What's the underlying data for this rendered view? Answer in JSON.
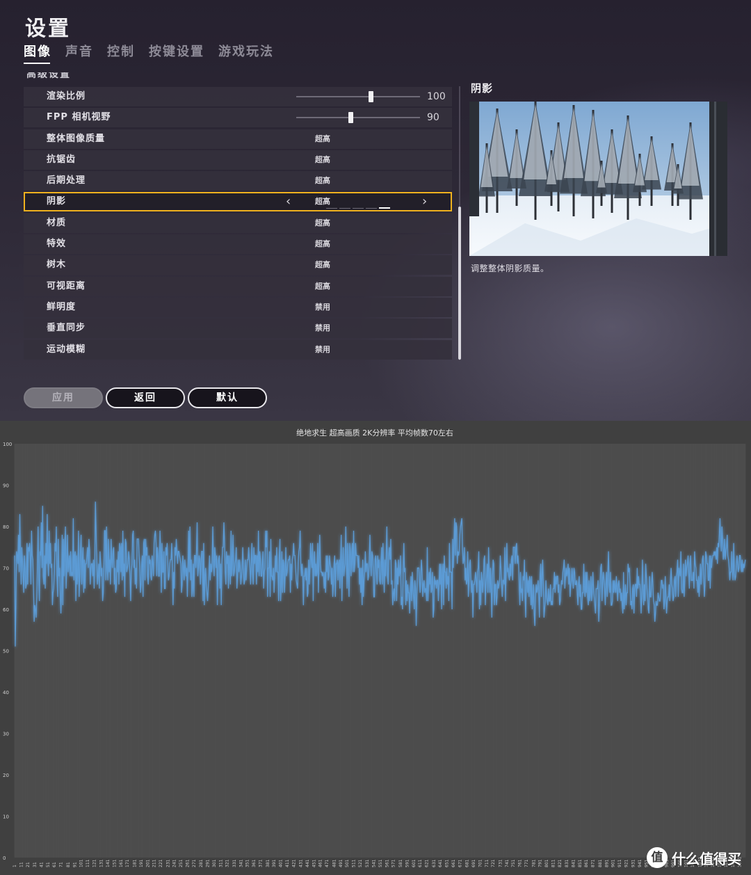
{
  "header": {
    "title": "设置",
    "tabs": [
      {
        "label": "图像",
        "active": true
      },
      {
        "label": "声音",
        "active": false
      },
      {
        "label": "控制",
        "active": false
      },
      {
        "label": "按键设置",
        "active": false
      },
      {
        "label": "游戏玩法",
        "active": false
      }
    ]
  },
  "section_label": "高级设置",
  "settings": {
    "rows": [
      {
        "label": "渲染比例",
        "type": "slider",
        "value": "100",
        "slider_fraction": 0.6
      },
      {
        "label": "FPP 相机视野",
        "type": "slider",
        "value": "90",
        "slider_fraction": 0.44
      },
      {
        "label": "整体图像质量",
        "type": "option",
        "value": "超高"
      },
      {
        "label": "抗锯齿",
        "type": "option",
        "value": "超高"
      },
      {
        "label": "后期处理",
        "type": "option",
        "value": "超高"
      },
      {
        "label": "阴影",
        "type": "option",
        "value": "超高",
        "selected": true,
        "level_index": 4,
        "level_count": 5
      },
      {
        "label": "材质",
        "type": "option",
        "value": "超高"
      },
      {
        "label": "特效",
        "type": "option",
        "value": "超高"
      },
      {
        "label": "树木",
        "type": "option",
        "value": "超高"
      },
      {
        "label": "可视距离",
        "type": "option",
        "value": "超高"
      },
      {
        "label": "鲜明度",
        "type": "option",
        "value": "禁用"
      },
      {
        "label": "垂直同步",
        "type": "option",
        "value": "禁用"
      },
      {
        "label": "运动模糊",
        "type": "option",
        "value": "禁用"
      }
    ],
    "arrow_left": "‹",
    "arrow_right": "›"
  },
  "preview": {
    "title": "阴影",
    "description": "调整整体阴影质量。",
    "image": "snowy-pine-forest-scene"
  },
  "buttons": {
    "apply": "应用",
    "back": "返回",
    "default": "默认"
  },
  "watermark": {
    "logo": "值",
    "text": "什么值得买"
  },
  "colors": {
    "accent_selected": "#f0b21e",
    "line": "#5b9bd5"
  },
  "chart_data": {
    "type": "line",
    "title": "绝地求生 超高画质 2K分辨率 平均帧数70左右",
    "xlabel": "",
    "ylabel": "",
    "ylim": [
      0,
      100
    ],
    "yticks": [
      0,
      10,
      20,
      30,
      40,
      50,
      60,
      70,
      80,
      90,
      100
    ],
    "x_range": [
      1,
      1100
    ],
    "xtick_step": 10,
    "grid": true,
    "series": [
      {
        "values": [
          73,
          51,
          61,
          74,
          73,
          71,
          78,
          69,
          83,
          73,
          66,
          75,
          72,
          68,
          64,
          73,
          70,
          65,
          66,
          76,
          66,
          75,
          74,
          76,
          73,
          66,
          79,
          73,
          72,
          65,
          57,
          61,
          60,
          58,
          63,
          71,
          80,
          67,
          62,
          74,
          73,
          81,
          70,
          85,
          68,
          66,
          73,
          65,
          76,
          71,
          83,
          72,
          68,
          79,
          71,
          76,
          70,
          71,
          61,
          64,
          65,
          69,
          76,
          74,
          80,
          68,
          63,
          77,
          68,
          70,
          64,
          59,
          64,
          78,
          61,
          77,
          68,
          75,
          80,
          65,
          70,
          78,
          69,
          71,
          73,
          68,
          74,
          68,
          69,
          68,
          82,
          67,
          73,
          74,
          62,
          73,
          66,
          69,
          79,
          63,
          68,
          74,
          78,
          66,
          72,
          75,
          64,
          72,
          65,
          71,
          71,
          73,
          75,
          70,
          77,
          74,
          66,
          70,
          71,
          71,
          68,
          72,
          65,
          72,
          86,
          79,
          72,
          66,
          68,
          71,
          65,
          74,
          71,
          68,
          70,
          62,
          64,
          71,
          79,
          79,
          67,
          80,
          70,
          67,
          77,
          69,
          72,
          66,
          77,
          72,
          70,
          74,
          75,
          66,
          70,
          64,
          65,
          72,
          69,
          74,
          66,
          76,
          75,
          69,
          76,
          67,
          79,
          68,
          71,
          63,
          77,
          76,
          69,
          70,
          71,
          74,
          72,
          68,
          62,
          69,
          71,
          78,
          79,
          70,
          72,
          66,
          70,
          65,
          77,
          77,
          77,
          73,
          70,
          64,
          66,
          71,
          73,
          63,
          76,
          77,
          67,
          77,
          73,
          75,
          68,
          66,
          73,
          71,
          72,
          68,
          67,
          73,
          71,
          68,
          76,
          78,
          79,
          76,
          68,
          75,
          73,
          68,
          68,
          79,
          74,
          64,
          76,
          69,
          69,
          74,
          65,
          65,
          75,
          73,
          76,
          71,
          67,
          68,
          71,
          72,
          72,
          76,
          70,
          61,
          69,
          65,
          75,
          73,
          77,
          74,
          71,
          74,
          74,
          73,
          72,
          71,
          64,
          66,
          73,
          70,
          67,
          72,
          70,
          68,
          70,
          63,
          70,
          79,
          69,
          80,
          67,
          72,
          63,
          65,
          71,
          63,
          73,
          73,
          70,
          74,
          81,
          68,
          70,
          73,
          72,
          66,
          71,
          74,
          74,
          62,
          76,
          61,
          68,
          70,
          66,
          64,
          62,
          65,
          68,
          73,
          67,
          71,
          69,
          71,
          80,
          72,
          68,
          75,
          73,
          70,
          73,
          61,
          70,
          72,
          73,
          65,
          71,
          61,
          71,
          75,
          75,
          81,
          76,
          69,
          66,
          74,
          71,
          73,
          65,
          73,
          70,
          66,
          79,
          68,
          72,
          78,
          68,
          69,
          71,
          72,
          75,
          65,
          68,
          72,
          69,
          72,
          70,
          66,
          68,
          70,
          75,
          70,
          66,
          67,
          72,
          67,
          70,
          72,
          72,
          75,
          72,
          70,
          66,
          71,
          76,
          69,
          66,
          75,
          71,
          73,
          73,
          66,
          73,
          69,
          79,
          68,
          74,
          72,
          68,
          68,
          71,
          74,
          65,
          69,
          70,
          79,
          75,
          79,
          63,
          70,
          70,
          74,
          63,
          77,
          68,
          68,
          67,
          70,
          64,
          68,
          73,
          69,
          75,
          69,
          69,
          62,
          73,
          77,
          62,
          66,
          74,
          64,
          72,
          71,
          64,
          68,
          75,
          68,
          69,
          71,
          72,
          72,
          73,
          64,
          71,
          67,
          72,
          73,
          76,
          73,
          73,
          70,
          67,
          66,
          65,
          71,
          74,
          75,
          79,
          71,
          68,
          71,
          68,
          61,
          68,
          68,
          70,
          67,
          70,
          63,
          64,
          72,
          66,
          70,
          76,
          72,
          70,
          76,
          62,
          71,
          74,
          68,
          71,
          68,
          69,
          76,
          64,
          72,
          78,
          71,
          69,
          69,
          68,
          69,
          68,
          65,
          69,
          64,
          73,
          69,
          73,
          67,
          68,
          73,
          71,
          70,
          66,
          70,
          63,
          66,
          71,
          73,
          63,
          71,
          71,
          72,
          67,
          71,
          72,
          65,
          72,
          78,
          62,
          70,
          75,
          68,
          70,
          71,
          80,
          72,
          65,
          76,
          68,
          63,
          76,
          74,
          68,
          72,
          76,
          69,
          79,
          69,
          71,
          76,
          73,
          73,
          73,
          70,
          73,
          66,
          70,
          64,
          70,
          61,
          72,
          63,
          67,
          69,
          74,
          69,
          71,
          71,
          67,
          68,
          72,
          78,
          71,
          68,
          74,
          73,
          70,
          63,
          63,
          72,
          73,
          69,
          66,
          73,
          70,
          72,
          67,
          66,
          71,
          75,
          66,
          76,
          69,
          64,
          72,
          68,
          73,
          80,
          68,
          66,
          73,
          75,
          72,
          77,
          66,
          67,
          61,
          64,
          65,
          62,
          72,
          71,
          62,
          70,
          66,
          72,
          68,
          69,
          73,
          61,
          63,
          60,
          69,
          76,
          69,
          70,
          61,
          67,
          62,
          66,
          64,
          64,
          59,
          64,
          68,
          62,
          69,
          65,
          63,
          60,
          67,
          65,
          56,
          63,
          70,
          70,
          70,
          67,
          64,
          68,
          72,
          69,
          63,
          66,
          67,
          64,
          65,
          65,
          62,
          75,
          62,
          66,
          69,
          66,
          70,
          64,
          65,
          69,
          58,
          60,
          68,
          66,
          67,
          65,
          67,
          67,
          62,
          66,
          71,
          66,
          71,
          60,
          68,
          71,
          61,
          73,
          69,
          69,
          65,
          70,
          66,
          68,
          62,
          76,
          69,
          69,
          69,
          60,
          77,
          70,
          76,
          82,
          73,
          81,
          80,
          71,
          74,
          73,
          74,
          78,
          80,
          81,
          82,
          75,
          71,
          72,
          75,
          67,
          70,
          66,
          67,
          74,
          63,
          67,
          71,
          72,
          67,
          64,
          67,
          58,
          66,
          66,
          67,
          69,
          67,
          64,
          69,
          70,
          74,
          60,
          67,
          61,
          69,
          67,
          64,
          67,
          72,
          73,
          61,
          66,
          68,
          71,
          64,
          75,
          69,
          64,
          70,
          65,
          58,
          68,
          72,
          71,
          61,
          66,
          66,
          61,
          63,
          67,
          65,
          66,
          67,
          73,
          70,
          66,
          63,
          67,
          67,
          66,
          75,
          62,
          70,
          76,
          69,
          70,
          68,
          67,
          71,
          68,
          72,
          73,
          67,
          75,
          75,
          75,
          71,
          75,
          76,
          71,
          73,
          71,
          66,
          61,
          69,
          64,
          65,
          62,
          68,
          67,
          72,
          63,
          58,
          69,
          67,
          64,
          67,
          63,
          68,
          67,
          61,
          68,
          60,
          62,
          66,
          59,
          56,
          63,
          66,
          64,
          65,
          67,
          63,
          58,
          68,
          71,
          63,
          68,
          72,
          66,
          58,
          60,
          62,
          67,
          63,
          62,
          61,
          65,
          62,
          62,
          66,
          61,
          62,
          61,
          65,
          65,
          69,
          64,
          68,
          66,
          68,
          68,
          64,
          66,
          61,
          62,
          65,
          67,
          66,
          69,
          70,
          72,
          65,
          68,
          70,
          68,
          69,
          71,
          66,
          70,
          63,
          66,
          67,
          70,
          67,
          65,
          70,
          69,
          66,
          66,
          67,
          64,
          61,
          66,
          68,
          63,
          66,
          60,
          60,
          64,
          64,
          71,
          65,
          63,
          69,
          64,
          69,
          63,
          61,
          67,
          62,
          64,
          68,
          62,
          64,
          69,
          65,
          63,
          61,
          59,
          65,
          65,
          65,
          67,
          57,
          61,
          66,
          70,
          71,
          62,
          67,
          69,
          67,
          65,
          61,
          66,
          69,
          63,
          69,
          74,
          66,
          64,
          69,
          61,
          61,
          62,
          67,
          64,
          67,
          65,
          64,
          68,
          65,
          62,
          66,
          67,
          64,
          65,
          62,
          64,
          61,
          59,
          69,
          60,
          63,
          66,
          61,
          64,
          64,
          71,
          69,
          70,
          66,
          61,
          62,
          60,
          65,
          66,
          59,
          65,
          66,
          66,
          63,
          70,
          65,
          68,
          66,
          66,
          64,
          59,
          64,
          72,
          65,
          61,
          66,
          62,
          71,
          68,
          65,
          63,
          60,
          59,
          68,
          63,
          63,
          66,
          69,
          66,
          62,
          61,
          57,
          59,
          62,
          61,
          61,
          64,
          63,
          62,
          62,
          64,
          67,
          67,
          65,
          66,
          60,
          62,
          68,
          63,
          59,
          62,
          63,
          63,
          66,
          62,
          67,
          70,
          66,
          65,
          62,
          63,
          67,
          68,
          63,
          68,
          69,
          72,
          63,
          70,
          69,
          68,
          74,
          65,
          64,
          64,
          71,
          63,
          67,
          72,
          68,
          70,
          71,
          73,
          69,
          65,
          71,
          73,
          67,
          67,
          67,
          69,
          65,
          74,
          71,
          70,
          67,
          67,
          64,
          68,
          63,
          67,
          71,
          66,
          69,
          72,
          73,
          68,
          63,
          66,
          74,
          73,
          71,
          71,
          67,
          67,
          73,
          65,
          73,
          70,
          72,
          73,
          73,
          74,
          73,
          74,
          72,
          75,
          71,
          76,
          75,
          78,
          82,
          77,
          74,
          80,
          77,
          72,
          73,
          77,
          72,
          74,
          75,
          78,
          73,
          72,
          70,
          67,
          69,
          69,
          74,
          70,
          67,
          76,
          69,
          67,
          68,
          70,
          73,
          71,
          69,
          70,
          73,
          73,
          71,
          69,
          72,
          69,
          71,
          70,
          71,
          72
        ]
      }
    ]
  }
}
